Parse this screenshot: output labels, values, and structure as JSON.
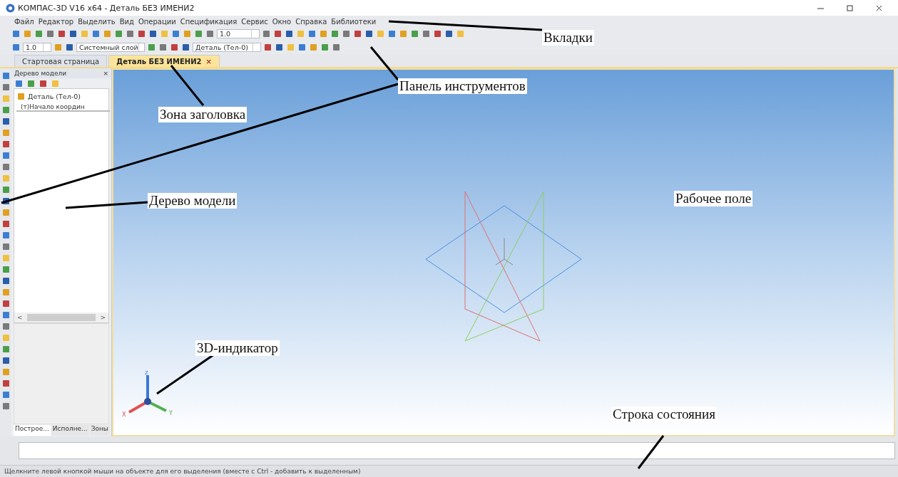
{
  "window": {
    "title": "КОМПАС-3D V16  x64 - Деталь БЕЗ ИМЕНИ2"
  },
  "menu": [
    "Файл",
    "Редактор",
    "Выделить",
    "Вид",
    "Операции",
    "Спецификация",
    "Сервис",
    "Окно",
    "Справка",
    "Библиотеки"
  ],
  "toolbar_1": {
    "scale": "1.0"
  },
  "toolbar_2": {
    "step": "1.0",
    "layer": "Системный слой",
    "body": "Деталь (Тел-0)"
  },
  "tabs": [
    {
      "label": "Стартовая страница",
      "selected": false
    },
    {
      "label": "Деталь БЕЗ ИМЕНИ2",
      "selected": true,
      "close": "×"
    }
  ],
  "tree_panel": {
    "title": "Дерево модели",
    "close": "×",
    "items": [
      {
        "label": "Деталь (Тел-0)",
        "children": [
          {
            "label": "(т)Начало координ"
          }
        ]
      }
    ],
    "scroll_left": "<",
    "scroll_right": ">",
    "bottom_tabs": [
      {
        "label": "Построе...",
        "selected": true
      },
      {
        "label": "Исполне...",
        "selected": false
      },
      {
        "label": "Зоны",
        "selected": false
      }
    ]
  },
  "indicator": {
    "axes": [
      "Z",
      "X",
      "Y"
    ]
  },
  "status_bar": {
    "text": "Щелкните левой кнопкой мыши на объекте для его выделения (вместе с Ctrl - добавить к выделенным)"
  },
  "annotations": [
    {
      "kind": "tabs",
      "text": "Вкладки"
    },
    {
      "kind": "toolbar",
      "text": "Панель инструментов"
    },
    {
      "kind": "header",
      "text": "Зона заголовка"
    },
    {
      "kind": "tree",
      "text": "Дерево модели"
    },
    {
      "kind": "field",
      "text": "Рабочее поле"
    },
    {
      "kind": "indicator",
      "text": "3D-индикатор"
    },
    {
      "kind": "status",
      "text": "Строка состояния"
    }
  ]
}
